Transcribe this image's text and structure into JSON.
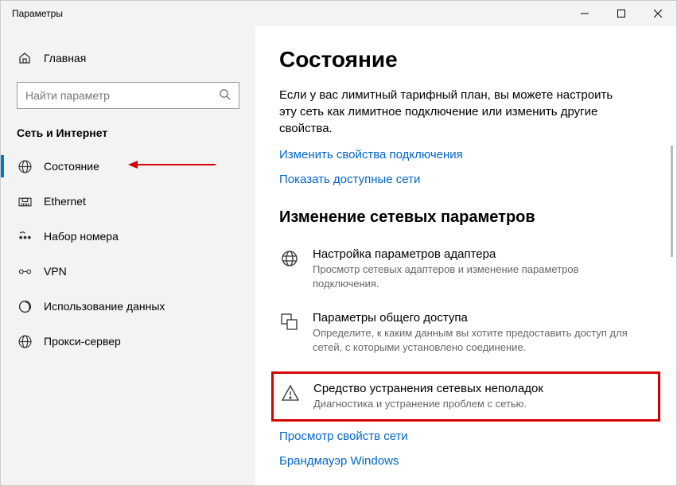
{
  "titlebar": {
    "title": "Параметры"
  },
  "sidebar": {
    "home_label": "Главная",
    "search_placeholder": "Найти параметр",
    "category": "Сеть и Интернет",
    "items": [
      {
        "label": "Состояние"
      },
      {
        "label": "Ethernet"
      },
      {
        "label": "Набор номера"
      },
      {
        "label": "VPN"
      },
      {
        "label": "Использование данных"
      },
      {
        "label": "Прокси-сервер"
      }
    ]
  },
  "main": {
    "title": "Состояние",
    "description": "Если у вас лимитный тарифный план, вы можете настроить эту сеть как лимитное подключение или изменить другие свойства.",
    "link_props": "Изменить свойства подключения",
    "link_networks": "Показать доступные сети",
    "section_heading": "Изменение сетевых параметров",
    "options": [
      {
        "title": "Настройка параметров адаптера",
        "sub": "Просмотр сетевых адаптеров и изменение параметров подключения."
      },
      {
        "title": "Параметры общего доступа",
        "sub": "Определите, к каким данным вы хотите предоставить доступ для сетей, с которыми установлено соединение."
      },
      {
        "title": "Средство устранения сетевых неполадок",
        "sub": "Диагностика и устранение проблем с сетью."
      }
    ],
    "link_view": "Просмотр свойств сети",
    "link_firewall": "Брандмауэр Windows"
  }
}
